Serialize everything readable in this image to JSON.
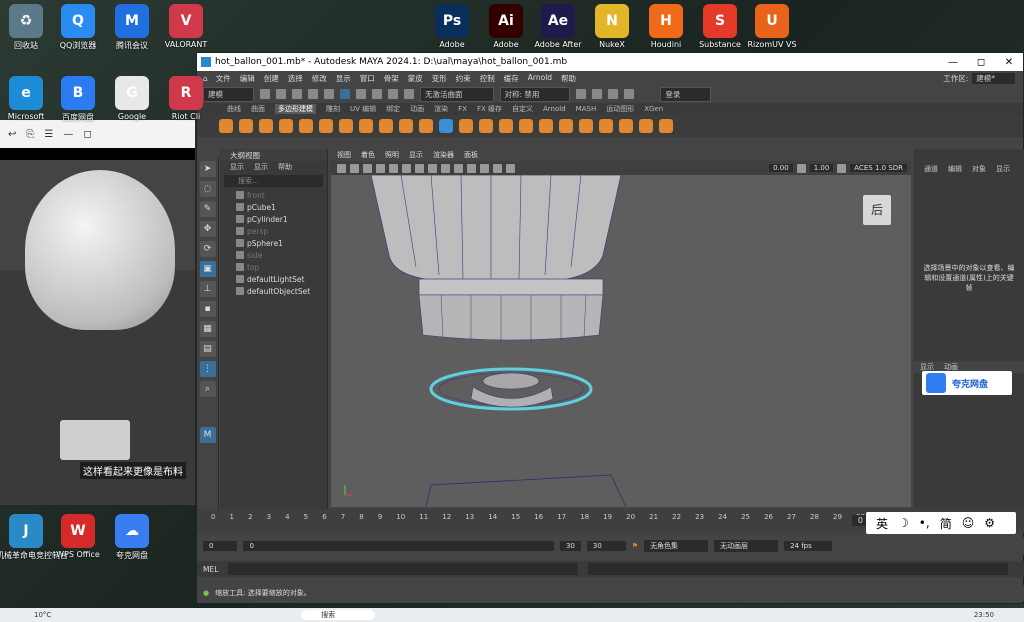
{
  "desktop": {
    "top_icons": [
      {
        "label": "回收站",
        "color": "#5a7a8a",
        "glyph": "♻"
      },
      {
        "label": "QQ浏览器",
        "color": "#2a8cf0",
        "glyph": "Q"
      },
      {
        "label": "腾讯会议",
        "color": "#1f6fe0",
        "glyph": "M"
      },
      {
        "label": "VALORANT",
        "color": "#d0394a",
        "glyph": "V"
      }
    ],
    "top_right_icons": [
      {
        "label": "Adobe",
        "color": "#0a2e5c",
        "glyph": "Ps"
      },
      {
        "label": "Adobe",
        "color": "#330000",
        "glyph": "Ai"
      },
      {
        "label": "Adobe After",
        "color": "#1e1a4c",
        "glyph": "Ae"
      },
      {
        "label": "NukeX",
        "color": "#e3b52a",
        "glyph": "N"
      },
      {
        "label": "Houdini",
        "color": "#f06a1a",
        "glyph": "H"
      },
      {
        "label": "Substance",
        "color": "#e43a2a",
        "glyph": "S"
      },
      {
        "label": "RizomUV VS",
        "color": "#e8641c",
        "glyph": "U"
      }
    ],
    "second_row": [
      {
        "label": "Microsoft",
        "color": "#1c8cd6",
        "glyph": "e"
      },
      {
        "label": "百度网盘",
        "color": "#2a7cf0",
        "glyph": "B"
      },
      {
        "label": "Google",
        "color": "#e8e8e8",
        "glyph": "G"
      },
      {
        "label": "Riot Cli",
        "color": "#d0394a",
        "glyph": "R"
      }
    ],
    "bottom_icons": [
      {
        "label": "机械革命电竞控制台",
        "color": "#2a8ac8",
        "glyph": "J"
      },
      {
        "label": "WPS Office",
        "color": "#d42a2a",
        "glyph": "W"
      },
      {
        "label": "夸克网盘",
        "color": "#3a7df0",
        "glyph": "☁"
      }
    ]
  },
  "video": {
    "subtitle": "这样看起来更像是布料"
  },
  "maya": {
    "title": "hot_ballon_001.mb* - Autodesk MAYA 2024.1: D:\\ual\\maya\\hot_ballon_001.mb",
    "menus": [
      "文件",
      "编辑",
      "创建",
      "选择",
      "修改",
      "显示",
      "窗口",
      "骨架",
      "蒙皮",
      "变形",
      "约束",
      "控制",
      "缓存",
      "Arnold",
      "帮助"
    ],
    "workspace_label": "工作区:",
    "workspace_value": "建模*",
    "mode_select": "建模",
    "live_surface": "无激活曲面",
    "symmetry": "对称: 禁用",
    "login": "登录",
    "shelf_tabs": [
      "曲线",
      "曲面",
      "多边形建模",
      "雕刻",
      "UV 编辑",
      "绑定",
      "动画",
      "渲染",
      "FX",
      "FX 缓存",
      "自定义",
      "Arnold",
      "MASH",
      "运动图形",
      "XGen"
    ],
    "shelf_active": "多边形建模",
    "outliner": {
      "title": "大纲视图",
      "menu": [
        "显示",
        "显示",
        "帮助"
      ],
      "search_placeholder": "搜索...",
      "items": [
        {
          "label": "front",
          "dim": true
        },
        {
          "label": "pCube1",
          "dim": false
        },
        {
          "label": "pCylinder1",
          "dim": false
        },
        {
          "label": "persp",
          "dim": true
        },
        {
          "label": "pSphere1",
          "dim": false
        },
        {
          "label": "side",
          "dim": true
        },
        {
          "label": "top",
          "dim": true
        },
        {
          "label": "defaultLightSet",
          "dim": false
        },
        {
          "label": "defaultObjectSet",
          "dim": false
        }
      ]
    },
    "viewport": {
      "menu": [
        "视图",
        "着色",
        "照明",
        "显示",
        "渲染器",
        "面板"
      ],
      "field_a": "0.00",
      "field_b": "1.00",
      "color_space": "ACES 1.0 SDR",
      "viewcube": "后"
    },
    "channel_box": {
      "tabs": [
        "通道",
        "编辑",
        "对象",
        "显示"
      ],
      "message": "选择场景中的对象以查看、编辑和设置通道(属性)上的关键帧",
      "layer_tabs": [
        "显示",
        "动画"
      ]
    },
    "cloud_popup": "夸克网盘",
    "timeline": {
      "ticks": [
        "0",
        "1",
        "2",
        "3",
        "4",
        "5",
        "6",
        "7",
        "8",
        "9",
        "10",
        "11",
        "12",
        "13",
        "14",
        "15",
        "16",
        "17",
        "18",
        "19",
        "20",
        "21",
        "22",
        "23",
        "24",
        "25",
        "26",
        "27",
        "28",
        "29",
        "30"
      ],
      "current": "0"
    },
    "range": {
      "start": "0",
      "inner_start": "0",
      "inner_end": "30",
      "end": "30",
      "char_set": "无角色集",
      "anim_layer": "无动画层",
      "fps": "24 fps"
    },
    "mel_label": "MEL",
    "help_text": "缩放工具: 选择要缩放的对象。"
  },
  "ime": {
    "items": [
      "英",
      "☽",
      "•,",
      "简",
      "☺",
      "⚙"
    ]
  },
  "taskbar": {
    "temp": "10°C",
    "search": "搜索",
    "time": "23:50"
  }
}
